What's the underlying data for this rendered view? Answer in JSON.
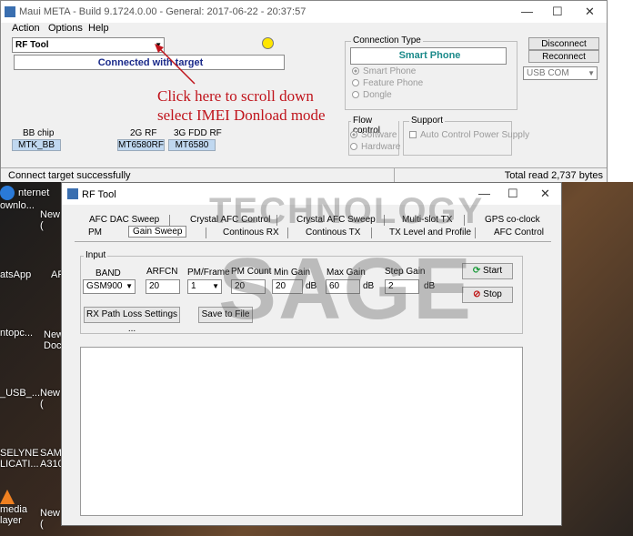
{
  "meta_window": {
    "title": "Maui META - Build 9.1724.0.00 - General: 2017-06-22 - 20:37:57",
    "menu": [
      "Action",
      "Options",
      "Help"
    ],
    "tool_select": "RF Tool",
    "connection_status": "Connected with target",
    "connection_type_label": "Connection Type",
    "connection_selected": "Smart Phone",
    "connection_options": [
      "Smart Phone",
      "Feature Phone",
      "Dongle"
    ],
    "disconnect_label": "Disconnect",
    "reconnect_label": "Reconnect",
    "port_select": "USB COM",
    "flow_control_label": "Flow control",
    "flow_options": [
      "Software",
      "Hardware"
    ],
    "support_label": "Support",
    "support_option": "Auto Control Power Supply",
    "bb_chip_label": "BB chip",
    "bb_chip_value": "MTK_BB",
    "rf2g_label": "2G RF",
    "rf2g_value": "MT6580RF",
    "rf3g_label": "3G FDD RF",
    "rf3g_value": "MT6580",
    "status_left": "Connect target successfully",
    "status_right": "Total read 2,737 bytes",
    "indicator_color": "#ffe600"
  },
  "annotation": {
    "line1": "Click here to scroll down",
    "line2": "select IMEI Donload mode",
    "color": "#c0141c"
  },
  "desktop_icons": [
    {
      "text": "nternet",
      "text2": "ownlo..."
    },
    {
      "text": "New",
      "text2": "("
    },
    {
      "text": "atsApp",
      "text2": ""
    },
    {
      "text": "AF",
      "text2": ""
    },
    {
      "text": "ntopc...",
      "text2": ""
    },
    {
      "text": "New",
      "text2": "Docu"
    },
    {
      "text": "_USB_...",
      "text2": ""
    },
    {
      "text": "New",
      "text2": "("
    },
    {
      "text": "SELYNE",
      "text2": "LICATI..."
    },
    {
      "text": "SAM",
      "text2": "A310"
    },
    {
      "text": "media",
      "text2": "layer"
    },
    {
      "text": "New",
      "text2": "("
    }
  ],
  "rf_window": {
    "title": "RF Tool",
    "tabs_row1": [
      "AFC DAC Sweep",
      "Crystal AFC Control",
      "Crystal AFC Sweep",
      "Multi-slot TX",
      "GPS co-clock"
    ],
    "tabs_row2": [
      "PM",
      "Gain Sweep",
      "Continous RX",
      "Continous TX",
      "TX Level and Profile",
      "AFC Control"
    ],
    "input_group": "Input",
    "band_label": "BAND",
    "band_value": "GSM900",
    "arfcn_label": "ARFCN",
    "arfcn_value": "20",
    "pmframe_label": "PM/Frame",
    "pmframe_value": "1",
    "pmcount_label": "PM Count",
    "pmcount_value": "20",
    "mingain_label": "Min Gain",
    "mingain_value": "20",
    "maxgain_label": "Max Gain",
    "maxgain_value": "60",
    "stepgain_label": "Step Gain",
    "stepgain_value": "2",
    "unit_db": "dB",
    "start_label": "Start",
    "stop_label": "Stop",
    "rx_path_label": "RX Path Loss Settings ...",
    "save_label": "Save to File"
  },
  "watermark": {
    "line1": "TECHNOLOGY",
    "line2": "SAGE"
  }
}
